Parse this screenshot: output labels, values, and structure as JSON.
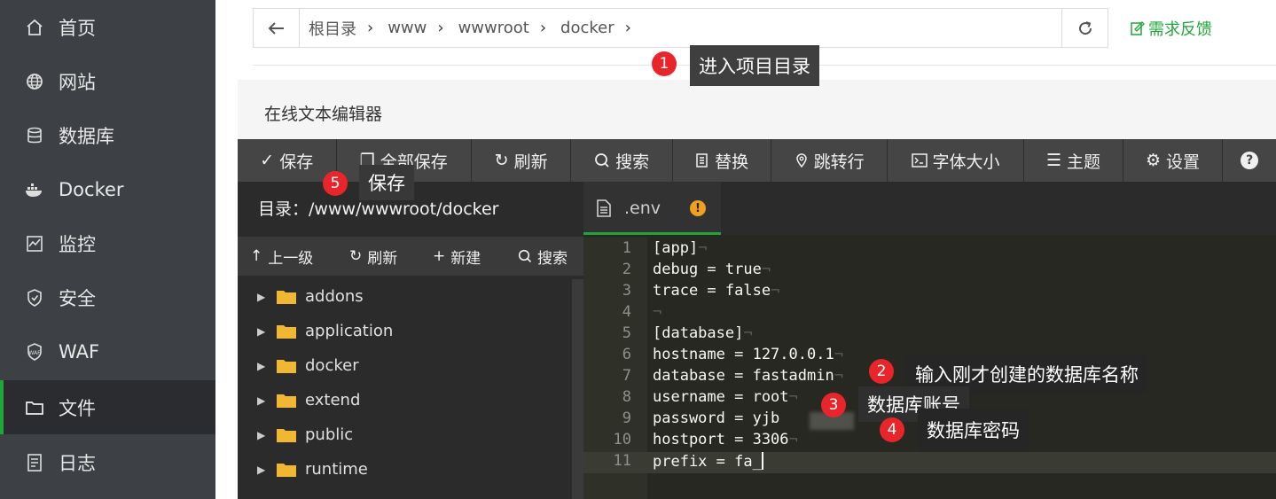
{
  "sidebar": {
    "items": [
      {
        "label": "首页",
        "icon": "home-icon"
      },
      {
        "label": "网站",
        "icon": "globe-icon"
      },
      {
        "label": "数据库",
        "icon": "database-icon"
      },
      {
        "label": "Docker",
        "icon": "docker-icon"
      },
      {
        "label": "监控",
        "icon": "monitor-icon"
      },
      {
        "label": "安全",
        "icon": "shield-icon"
      },
      {
        "label": "WAF",
        "icon": "waf-icon"
      },
      {
        "label": "文件",
        "icon": "folder-icon",
        "active": true
      },
      {
        "label": "日志",
        "icon": "log-icon"
      }
    ],
    "active_color": "#20a53a"
  },
  "breadcrumb": {
    "items": [
      "根目录",
      "www",
      "wwwroot",
      "docker"
    ]
  },
  "feedback_label": "需求反馈",
  "editor": {
    "title": "在线文本编辑器",
    "toolbar": [
      "保存",
      "全部保存",
      "刷新",
      "搜索",
      "替换",
      "跳转行",
      "字体大小",
      "主题",
      "设置"
    ],
    "directory_label": "目录：/www/wwwroot/docker",
    "file_tools": [
      "上一级",
      "刷新",
      "新建",
      "搜索"
    ],
    "files": [
      "addons",
      "application",
      "docker",
      "extend",
      "public",
      "runtime"
    ],
    "open_tab": ".env",
    "code": [
      {
        "n": "1",
        "text": "[app]"
      },
      {
        "n": "2",
        "text": "debug = true"
      },
      {
        "n": "3",
        "text": "trace = false"
      },
      {
        "n": "4",
        "text": ""
      },
      {
        "n": "5",
        "text": "[database]"
      },
      {
        "n": "6",
        "text": "hostname = 127.0.0.1"
      },
      {
        "n": "7",
        "text": "database = fastadmin"
      },
      {
        "n": "8",
        "text": "username = root"
      },
      {
        "n": "9",
        "text": "password = yjb"
      },
      {
        "n": "10",
        "text": "hostport = 3306"
      },
      {
        "n": "11",
        "text": "prefix = fa_"
      }
    ]
  },
  "annotations": [
    {
      "num": "1",
      "text": "进入项目目录"
    },
    {
      "num": "2",
      "text": "输入刚才创建的数据库名称"
    },
    {
      "num": "3",
      "text": "数据库账号"
    },
    {
      "num": "4",
      "text": "数据库密码"
    },
    {
      "num": "5",
      "text": "保存"
    }
  ]
}
